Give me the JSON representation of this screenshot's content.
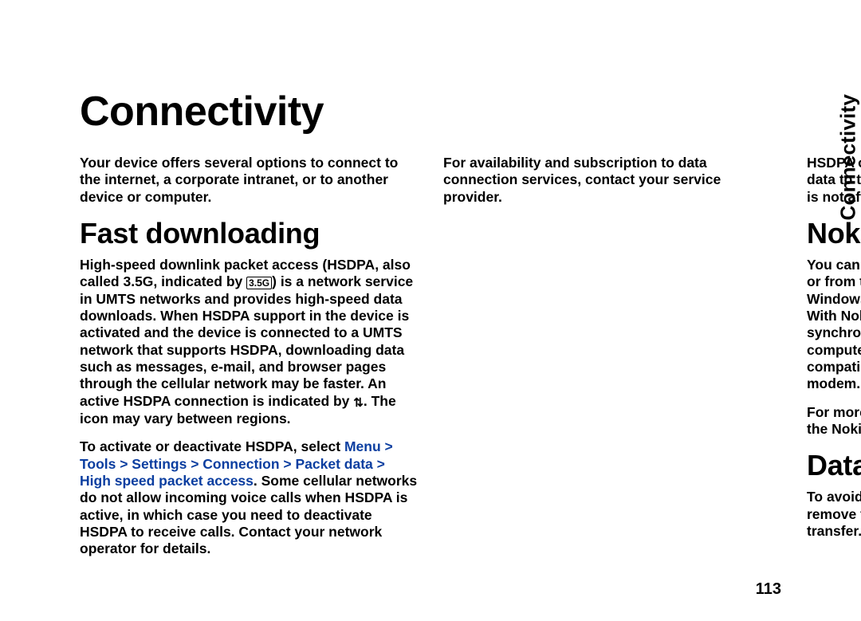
{
  "sideLabel": "Connectivity",
  "pageTitle": "Connectivity",
  "intro": "Your device offers several options to connect to the internet, a corporate intranet, or to another device or computer.",
  "fast": {
    "heading": "Fast downloading",
    "p1a": "High-speed downlink packet access (HSDPA, also called 3.5G, indicated by ",
    "icon35g": "3.5G",
    "p1b": ") is a network service in UMTS networks and provides high-speed data downloads. When HSDPA support in the device is activated and the device is connected to a UMTS network that supports HSDPA, downloading data such as messages, e-mail, and browser pages through the cellular network may be faster. An active HSDPA connection is indicated by ",
    "iconConn": "⇅",
    "p1c": ". The icon may vary between regions.",
    "p2a": "To activate or deactivate HSDPA, select ",
    "menuPath": "Menu > Tools > Settings > Connection > Packet data > High speed packet access",
    "p2b": ". Some cellular networks do not allow incoming voice calls when HSDPA is active, in which case you need to deactivate HSDPA to receive calls. Contact your network operator for details.",
    "p3": "For availability and subscription to data connection services, contact your service provider.",
    "p4": "HSDPA only affects the download speed; sending data to the network, such as messages and e-mail, is not affected."
  },
  "pcsuite": {
    "heading": "Nokia PC Suite",
    "p1": "You can install Nokia PC Suite from the CD-ROM or from the web. Nokia PC Suite can be used with Windows 2000, Windows XP, and Windows Vista. With Nokia PC Suite, you can make backups, synchronise your device with a compatible computer, move files between your device and a compatible computer, or use your device as a modem.",
    "p2": "For more information about Nokia PC Suite, see the Nokia PC Suite guide."
  },
  "datacable": {
    "heading": "Data cable",
    "p1": "To avoid damaging the memory card, do not remove the data cable in the middle of a data transfer."
  },
  "pageNumber": "113"
}
